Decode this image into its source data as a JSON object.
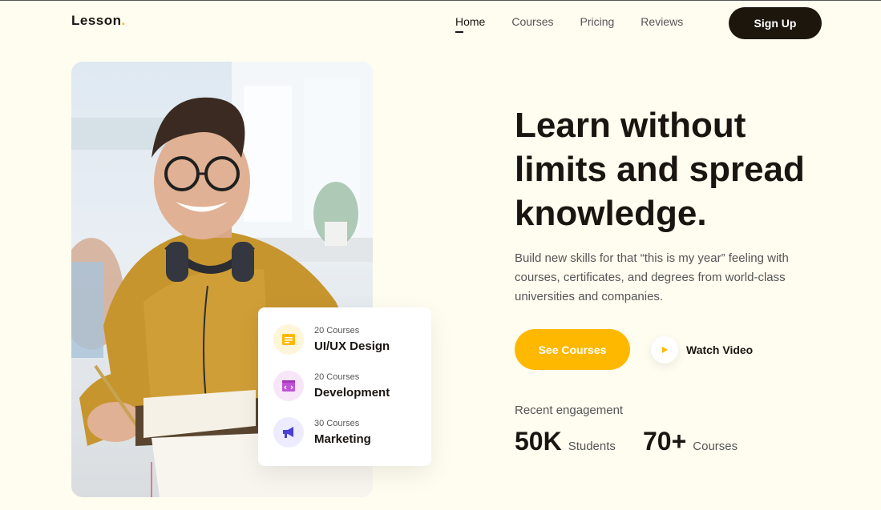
{
  "brand": {
    "name": "Lesson",
    "dot": "."
  },
  "nav": {
    "items": [
      {
        "label": "Home",
        "active": true
      },
      {
        "label": "Courses",
        "active": false
      },
      {
        "label": "Pricing",
        "active": false
      },
      {
        "label": "Reviews",
        "active": false
      }
    ],
    "signup_label": "Sign Up"
  },
  "hero": {
    "title_lines": [
      "Learn without",
      "limits and spread",
      "knowledge."
    ],
    "description_lines": [
      "Build new skills for that “this is my year” feeling with",
      "courses, certificates, and degrees from world-class",
      "universities and companies."
    ],
    "primary_cta": "See Courses",
    "secondary_cta": "Watch Video"
  },
  "categories": [
    {
      "count": "20 Courses",
      "title": "UI/UX Design",
      "icon": "document-icon",
      "bg": "#fff5d9",
      "color": "#ffb800"
    },
    {
      "count": "20 Courses",
      "title": "Development",
      "icon": "code-window-icon",
      "bg": "#f7e5f8",
      "color": "#c050d6"
    },
    {
      "count": "30 Courses",
      "title": "Marketing",
      "icon": "megaphone-icon",
      "bg": "#ecebff",
      "color": "#4a3fd6"
    }
  ],
  "engagement": {
    "label": "Recent engagement",
    "stats": [
      {
        "value": "50K",
        "unit": "Students"
      },
      {
        "value": "70+",
        "unit": "Courses"
      }
    ]
  },
  "colors": {
    "accent": "#ffb800",
    "dark": "#1c160d",
    "background": "#fffcf0"
  }
}
